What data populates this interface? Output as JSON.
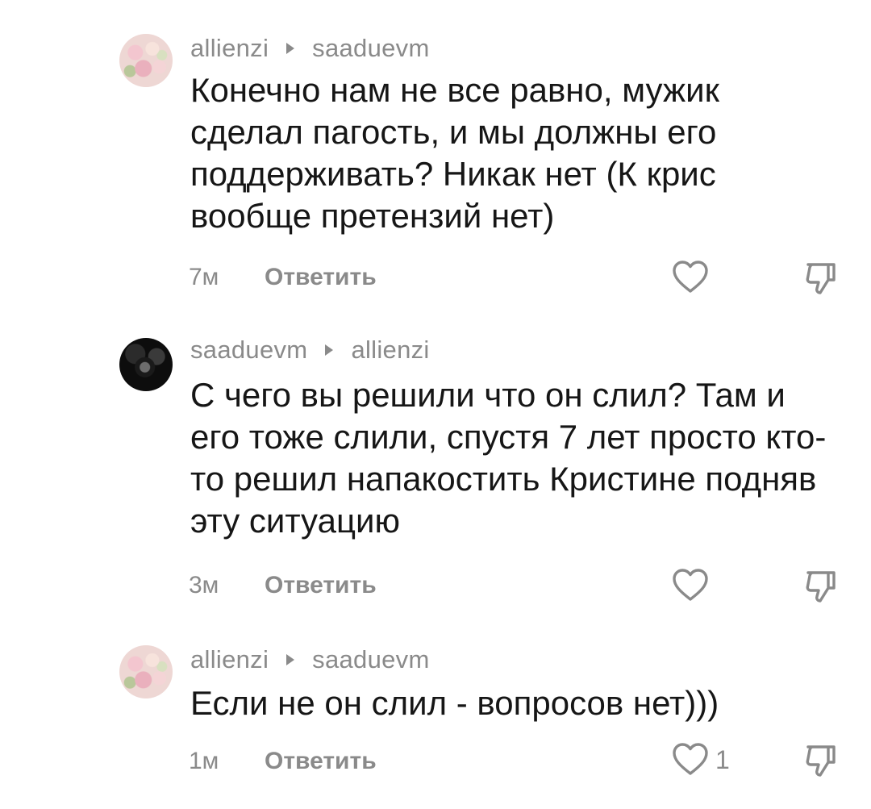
{
  "comments": [
    {
      "author": "allienzi",
      "reply_to": "saaduevm",
      "avatar_icon": "flowers-avatar",
      "text": "Конечно нам не все равно, мужик сделал пагость, и мы должны его поддерживать? Никак нет (К крис вообще претензий нет)",
      "time": "7м",
      "reply_label": "Ответить",
      "likes": ""
    },
    {
      "author": "saaduevm",
      "reply_to": "allienzi",
      "avatar_icon": "dark-avatar",
      "text": "С чего вы решили что он слил? Там и его тоже слили, спустя 7 лет просто кто-то решил напакостить Кристине подняв эту ситуацию",
      "time": "3м",
      "reply_label": "Ответить",
      "likes": ""
    },
    {
      "author": "allienzi",
      "reply_to": "saaduevm",
      "avatar_icon": "flowers-avatar",
      "text": "Если не он слил - вопросов нет)))",
      "time": "1м",
      "reply_label": "Ответить",
      "likes": "1"
    }
  ],
  "icons": {
    "like": "heart-icon",
    "dislike": "thumbs-down-icon",
    "separator": "triangle-right-icon"
  },
  "colors": {
    "text": "#161616",
    "muted": "#8a8a8a",
    "background": "#ffffff"
  }
}
